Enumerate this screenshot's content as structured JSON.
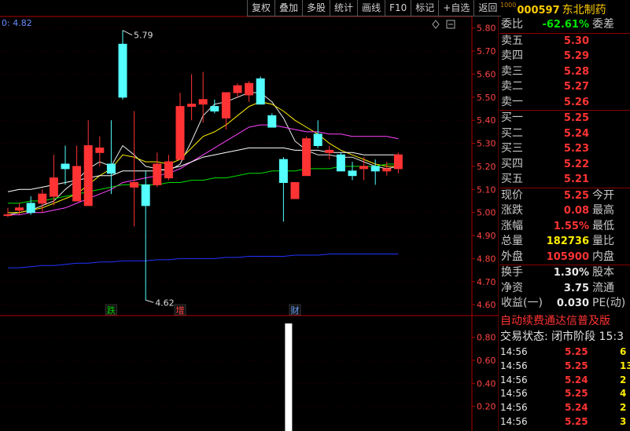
{
  "toolbar": {
    "items": [
      "复权",
      "叠加",
      "多股",
      "统计",
      "画线",
      "F10",
      "标记",
      "+自选",
      "返回"
    ]
  },
  "stock": {
    "code_prefix": "1000",
    "code": "000597",
    "name": "东北制药"
  },
  "chart_data": {
    "type": "candlestick",
    "corner_value": "0: 4.82",
    "ylim": [
      4.58,
      5.84
    ],
    "y_ticks": [
      "5.80",
      "5.70",
      "5.60",
      "5.50",
      "5.40",
      "5.30",
      "5.20",
      "5.10",
      "5.00",
      "4.90",
      "4.80",
      "4.70",
      "4.60"
    ],
    "high_marker": "5.79",
    "low_marker": "4.62",
    "event_tags": [
      {
        "label": "跌",
        "color": "#00cc00"
      },
      {
        "label": "增",
        "color": "#ff4444"
      },
      {
        "label": "财",
        "color": "#6aa0ff"
      }
    ],
    "candles": [
      {
        "o": 4.99,
        "h": 5.02,
        "l": 4.98,
        "c": 4.99
      },
      {
        "o": 5.01,
        "h": 5.04,
        "l": 4.99,
        "c": 5.02
      },
      {
        "o": 5.04,
        "h": 5.07,
        "l": 4.99,
        "c": 5.0
      },
      {
        "o": 5.04,
        "h": 5.1,
        "l": 5.0,
        "c": 5.08
      },
      {
        "o": 5.07,
        "h": 5.25,
        "l": 5.03,
        "c": 5.15
      },
      {
        "o": 5.21,
        "h": 5.29,
        "l": 5.12,
        "c": 5.19
      },
      {
        "o": 5.05,
        "h": 5.29,
        "l": 5.05,
        "c": 5.2
      },
      {
        "o": 5.03,
        "h": 5.4,
        "l": 5.03,
        "c": 5.29
      },
      {
        "o": 5.26,
        "h": 5.33,
        "l": 5.2,
        "c": 5.28
      },
      {
        "o": 5.21,
        "h": 5.4,
        "l": 5.08,
        "c": 5.17
      },
      {
        "o": 5.73,
        "h": 5.79,
        "l": 5.49,
        "c": 5.5
      },
      {
        "o": 5.11,
        "h": 5.44,
        "l": 4.94,
        "c": 5.13
      },
      {
        "o": 5.12,
        "h": 5.18,
        "l": 4.62,
        "c": 5.03
      },
      {
        "o": 5.12,
        "h": 5.26,
        "l": 5.11,
        "c": 5.21
      },
      {
        "o": 5.15,
        "h": 5.25,
        "l": 5.14,
        "c": 5.22
      },
      {
        "o": 5.23,
        "h": 5.52,
        "l": 5.23,
        "c": 5.46
      },
      {
        "o": 5.46,
        "h": 5.6,
        "l": 5.4,
        "c": 5.47
      },
      {
        "o": 5.47,
        "h": 5.61,
        "l": 5.39,
        "c": 5.49
      },
      {
        "o": 5.46,
        "h": 5.49,
        "l": 5.43,
        "c": 5.44
      },
      {
        "o": 5.41,
        "h": 5.52,
        "l": 5.36,
        "c": 5.52
      },
      {
        "o": 5.52,
        "h": 5.56,
        "l": 5.5,
        "c": 5.55
      },
      {
        "o": 5.51,
        "h": 5.57,
        "l": 5.48,
        "c": 5.56
      },
      {
        "o": 5.58,
        "h": 5.59,
        "l": 5.48,
        "c": 5.47
      },
      {
        "o": 5.42,
        "h": 5.43,
        "l": 5.38,
        "c": 5.37
      },
      {
        "o": 5.23,
        "h": 5.24,
        "l": 4.96,
        "c": 5.13
      },
      {
        "o": 5.06,
        "h": 5.11,
        "l": 5.06,
        "c": 5.13
      },
      {
        "o": 5.16,
        "h": 5.33,
        "l": 5.16,
        "c": 5.32
      },
      {
        "o": 5.34,
        "h": 5.4,
        "l": 5.28,
        "c": 5.29
      },
      {
        "o": 5.26,
        "h": 5.29,
        "l": 5.23,
        "c": 5.27
      },
      {
        "o": 5.25,
        "h": 5.26,
        "l": 5.18,
        "c": 5.18
      },
      {
        "o": 5.18,
        "h": 5.22,
        "l": 5.14,
        "c": 5.16
      },
      {
        "o": 5.19,
        "h": 5.24,
        "l": 5.14,
        "c": 5.2
      },
      {
        "o": 5.2,
        "h": 5.23,
        "l": 5.12,
        "c": 5.18
      },
      {
        "o": 5.18,
        "h": 5.22,
        "l": 5.16,
        "c": 5.19
      },
      {
        "o": 5.19,
        "h": 5.26,
        "l": 5.17,
        "c": 5.25
      }
    ],
    "ma_lines": [
      {
        "color": "#e8e8e8",
        "values": [
          4.99,
          5.0,
          5.01,
          5.03,
          5.05,
          5.1,
          5.14,
          5.19,
          5.22,
          5.2,
          5.29,
          5.25,
          5.2,
          5.19,
          5.18,
          5.21,
          5.31,
          5.42,
          5.47,
          5.48,
          5.5,
          5.52,
          5.52,
          5.48,
          5.41,
          5.31,
          5.27,
          5.25,
          5.25,
          5.24,
          5.24,
          5.22,
          5.2,
          5.19,
          5.2
        ]
      },
      {
        "color": "#ffee00",
        "values": [
          5.0,
          5.0,
          5.01,
          5.02,
          5.04,
          5.06,
          5.08,
          5.12,
          5.16,
          5.19,
          5.25,
          5.24,
          5.22,
          5.22,
          5.21,
          5.23,
          5.28,
          5.33,
          5.35,
          5.38,
          5.42,
          5.46,
          5.48,
          5.47,
          5.44,
          5.4,
          5.37,
          5.34,
          5.3,
          5.27,
          5.25,
          5.23,
          5.21,
          5.2,
          5.2
        ]
      },
      {
        "color": "#ff44ff",
        "values": [
          4.99,
          4.99,
          5.0,
          5.0,
          5.01,
          5.02,
          5.04,
          5.06,
          5.08,
          5.1,
          5.13,
          5.14,
          5.15,
          5.16,
          5.17,
          5.19,
          5.22,
          5.25,
          5.28,
          5.31,
          5.34,
          5.37,
          5.38,
          5.38,
          5.37,
          5.36,
          5.35,
          5.35,
          5.34,
          5.34,
          5.33,
          5.33,
          5.33,
          5.33,
          5.32
        ]
      },
      {
        "color": "#00e000",
        "values": [
          5.04,
          5.04,
          5.05,
          5.05,
          5.06,
          5.07,
          5.08,
          5.09,
          5.1,
          5.11,
          5.12,
          5.12,
          5.12,
          5.12,
          5.13,
          5.13,
          5.14,
          5.14,
          5.15,
          5.15,
          5.16,
          5.17,
          5.17,
          5.18,
          5.18,
          5.18,
          5.19,
          5.19,
          5.19,
          5.2,
          5.2,
          5.2,
          5.2,
          5.21,
          5.21
        ]
      },
      {
        "color": "#2233ff",
        "values": [
          4.76,
          4.76,
          4.765,
          4.77,
          4.77,
          4.775,
          4.78,
          4.78,
          4.785,
          4.785,
          4.79,
          4.79,
          4.79,
          4.795,
          4.795,
          4.8,
          4.8,
          4.8,
          4.8,
          4.805,
          4.805,
          4.81,
          4.81,
          4.81,
          4.81,
          4.815,
          4.815,
          4.815,
          4.82,
          4.82,
          4.82,
          4.82,
          4.82,
          4.82,
          4.82
        ]
      },
      {
        "color": "#ffffff",
        "values": [
          5.09,
          5.1,
          5.1,
          5.11,
          5.12,
          5.13,
          5.14,
          5.15,
          5.16,
          5.16,
          5.18,
          5.18,
          5.18,
          5.18,
          5.19,
          5.2,
          5.22,
          5.24,
          5.25,
          5.26,
          5.27,
          5.28,
          5.28,
          5.28,
          5.28,
          5.27,
          5.27,
          5.27,
          5.26,
          5.26,
          5.26,
          5.25,
          5.25,
          5.25,
          5.25
        ]
      }
    ],
    "sub_chart": {
      "ylim": [
        0,
        0.92
      ],
      "y_ticks": [
        "0.80",
        "0.60",
        "0.40",
        "0.20"
      ],
      "bar_values": [
        {
          "index": 24,
          "value": 0.92
        }
      ]
    }
  },
  "quote": {
    "weibi_label": "委比",
    "weibi_value": "-62.61%",
    "weicha_label": "委差",
    "asks": [
      {
        "label": "卖五",
        "price": "5.30"
      },
      {
        "label": "卖四",
        "price": "5.29"
      },
      {
        "label": "卖三",
        "price": "5.28"
      },
      {
        "label": "卖二",
        "price": "5.27"
      },
      {
        "label": "卖一",
        "price": "5.26"
      }
    ],
    "bids": [
      {
        "label": "买一",
        "price": "5.25"
      },
      {
        "label": "买二",
        "price": "5.24"
      },
      {
        "label": "买三",
        "price": "5.23"
      },
      {
        "label": "买四",
        "price": "5.22"
      },
      {
        "label": "买五",
        "price": "5.21"
      }
    ],
    "stats": [
      {
        "label": "现价",
        "value": "5.25",
        "label2": "今开",
        "color": "red"
      },
      {
        "label": "涨跌",
        "value": "0.08",
        "label2": "最高",
        "color": "red"
      },
      {
        "label": "涨幅",
        "value": "1.55%",
        "label2": "最低",
        "color": "red"
      },
      {
        "label": "总量",
        "value": "182736",
        "label2": "量比",
        "color": "yellow"
      },
      {
        "label": "外盘",
        "value": "105900",
        "label2": "内盘",
        "color": "red"
      }
    ],
    "stats2": [
      {
        "label": "换手",
        "value": "1.30%",
        "label2": "股本",
        "color": "white"
      },
      {
        "label": "净资",
        "value": "3.75",
        "label2": "流通",
        "color": "white"
      },
      {
        "label": "收益(一)",
        "value": "0.030",
        "label2": "PE(动)",
        "color": "white"
      }
    ],
    "notice": "自动续费通达信普及版",
    "status": "交易状态: 闭市阶段 15:3",
    "trades": [
      {
        "time": "14:56",
        "price": "5.25",
        "vol": "6",
        "pc": "red",
        "vc": "yellow"
      },
      {
        "time": "14:56",
        "price": "5.25",
        "vol": "13",
        "pc": "red",
        "vc": "yellow"
      },
      {
        "time": "14:56",
        "price": "5.24",
        "vol": "2",
        "pc": "red",
        "vc": "yellow"
      },
      {
        "time": "14:56",
        "price": "5.25",
        "vol": "4",
        "pc": "red",
        "vc": "yellow"
      },
      {
        "time": "14:56",
        "price": "5.24",
        "vol": "2",
        "pc": "red",
        "vc": "yellow"
      },
      {
        "time": "14:56",
        "price": "5.25",
        "vol": "3",
        "pc": "red",
        "vc": "yellow"
      }
    ]
  }
}
